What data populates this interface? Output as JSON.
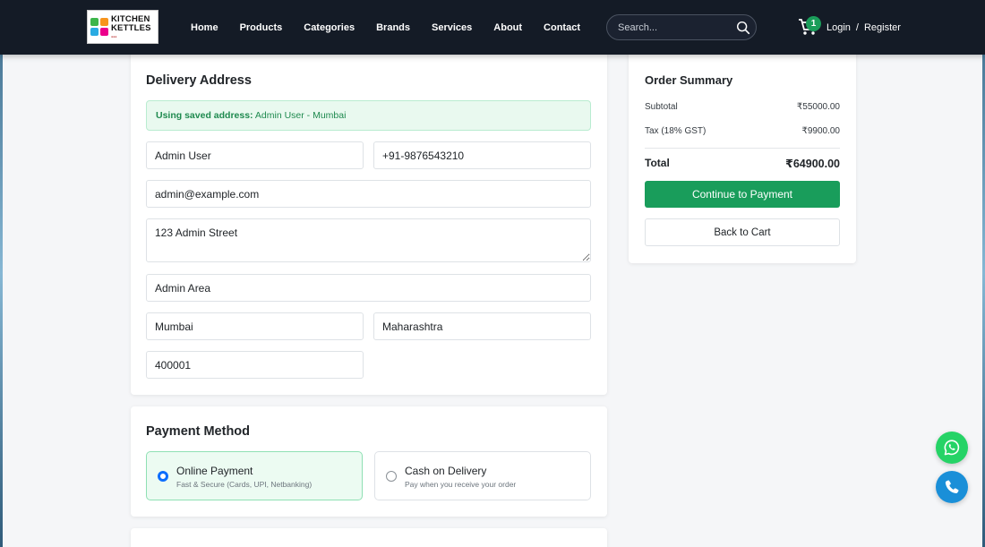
{
  "brand": {
    "name_line1": "KITCHEN",
    "name_line2": "KETTLES",
    "tile_colors": [
      "#3cb54a",
      "#f7941d",
      "#29abe2",
      "#ec008c"
    ]
  },
  "nav": {
    "items": [
      {
        "label": "Home"
      },
      {
        "label": "Products"
      },
      {
        "label": "Categories"
      },
      {
        "label": "Brands"
      },
      {
        "label": "Services"
      },
      {
        "label": "About"
      },
      {
        "label": "Contact"
      }
    ]
  },
  "search": {
    "placeholder": "Search..."
  },
  "cart": {
    "count": "1"
  },
  "auth": {
    "login": "Login",
    "separator": "/",
    "register": "Register"
  },
  "delivery": {
    "title": "Delivery Address",
    "saved_prefix": "Using saved address:",
    "saved_value": "Admin User - Mumbai",
    "fields": {
      "name": "Admin User",
      "phone": "+91-9876543210",
      "email": "admin@example.com",
      "address": "123 Admin Street",
      "area": "Admin Area",
      "city": "Mumbai",
      "state": "Maharashtra",
      "pincode": "400001"
    }
  },
  "payment": {
    "title": "Payment Method",
    "options": [
      {
        "label": "Online Payment",
        "sub": "Fast & Secure (Cards, UPI, Netbanking)",
        "selected": true
      },
      {
        "label": "Cash on Delivery",
        "sub": "Pay when you receive your order",
        "selected": false
      }
    ]
  },
  "summary": {
    "title": "Order Summary",
    "subtotal_label": "Subtotal",
    "subtotal_value": "₹55000.00",
    "tax_label": "Tax (18% GST)",
    "tax_value": "₹9900.00",
    "total_label": "Total",
    "total_value": "₹64900.00",
    "continue_label": "Continue to Payment",
    "back_label": "Back to Cart"
  },
  "colors": {
    "header_bg": "#141b26",
    "accent_green": "#199d5b",
    "radio_blue": "#0d6efd",
    "whatsapp": "#25d366",
    "phone": "#1a8fd8"
  }
}
